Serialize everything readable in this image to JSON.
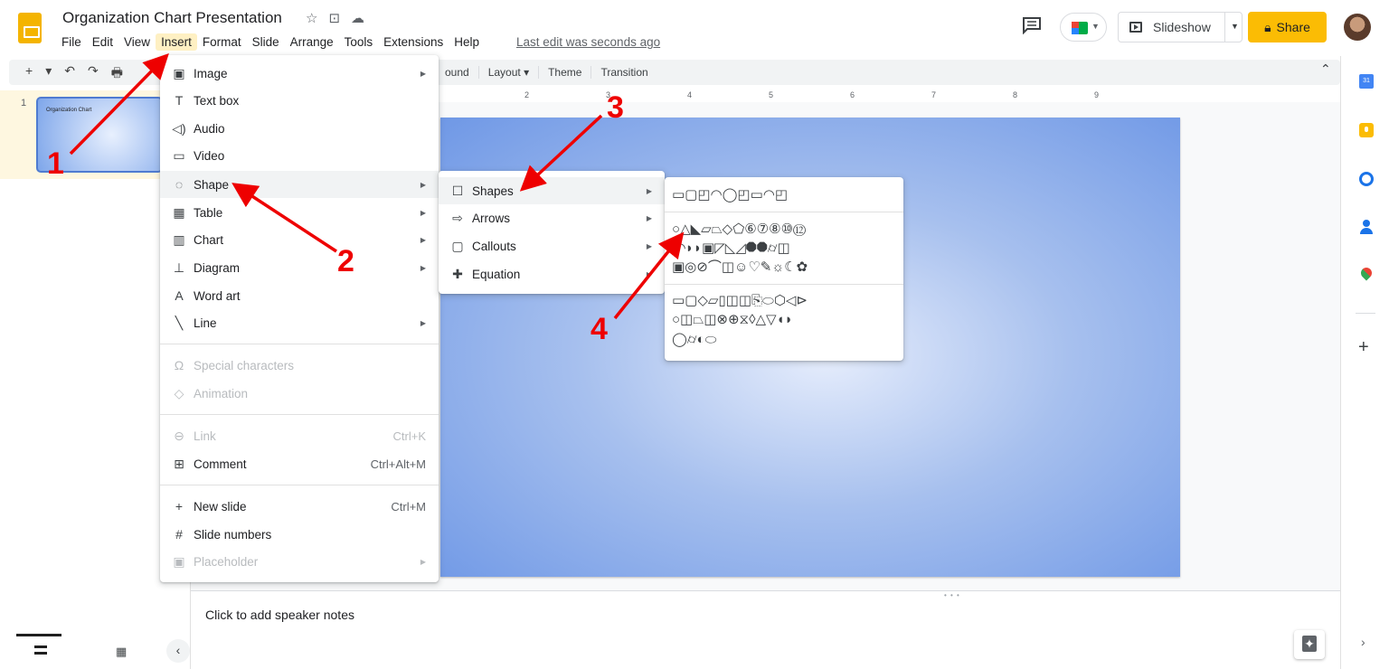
{
  "header": {
    "title": "Organization Chart Presentation",
    "menus": [
      "File",
      "Edit",
      "View",
      "Insert",
      "Format",
      "Slide",
      "Arrange",
      "Tools",
      "Extensions",
      "Help"
    ],
    "active_menu": "Insert",
    "last_edit": "Last edit was seconds ago",
    "slideshow_label": "Slideshow",
    "share_label": "Share",
    "title_icons": [
      "☆",
      "⊡",
      "☁"
    ]
  },
  "toolbar": {
    "left_icons": [
      "+",
      "▾",
      "↶",
      "↷",
      "🖶"
    ],
    "right_items": [
      "ound",
      "Layout ▾",
      "Theme",
      "Transition"
    ],
    "collapse": "⌃"
  },
  "ruler": [
    "2",
    "3",
    "4",
    "5",
    "6",
    "7",
    "8",
    "9"
  ],
  "filmstrip": {
    "slide_number": "1",
    "thumb_title": "Organization Chart"
  },
  "notes": {
    "placeholder": "Click to add speaker notes"
  },
  "side_panel": {
    "calendar_day": "31",
    "add": "+",
    "expand": "›"
  },
  "insert_menu": [
    {
      "icon": "▣",
      "label": "Image",
      "submenu": true
    },
    {
      "icon": "T",
      "label": "Text box"
    },
    {
      "icon": "◁)",
      "label": "Audio"
    },
    {
      "icon": "▭",
      "label": "Video"
    },
    {
      "icon": "◌",
      "label": "Shape",
      "submenu": true,
      "highlight": true
    },
    {
      "icon": "▦",
      "label": "Table",
      "submenu": true
    },
    {
      "icon": "▥",
      "label": "Chart",
      "submenu": true
    },
    {
      "icon": "⊥",
      "label": "Diagram",
      "submenu": true
    },
    {
      "icon": "A",
      "label": "Word art"
    },
    {
      "icon": "╲",
      "label": "Line",
      "submenu": true
    },
    {
      "icon": "Ω",
      "label": "Special characters",
      "disabled": true
    },
    {
      "icon": "◇",
      "label": "Animation",
      "disabled": true
    },
    {
      "icon": "⊖",
      "label": "Link",
      "shortcut": "Ctrl+K",
      "disabled": true
    },
    {
      "icon": "⊞",
      "label": "Comment",
      "shortcut": "Ctrl+Alt+M"
    },
    {
      "icon": "+",
      "label": "New slide",
      "shortcut": "Ctrl+M"
    },
    {
      "icon": "#",
      "label": "Slide numbers"
    },
    {
      "icon": "▣",
      "label": "Placeholder",
      "submenu": true,
      "disabled": true
    }
  ],
  "shape_menu": [
    {
      "icon": "☐",
      "label": "Shapes",
      "submenu": true,
      "highlight": true
    },
    {
      "icon": "⇨",
      "label": "Arrows",
      "submenu": true
    },
    {
      "icon": "▢",
      "label": "Callouts",
      "submenu": true
    },
    {
      "icon": "✚",
      "label": "Equation",
      "submenu": true
    }
  ],
  "shapes_rows": [
    "▭▢◰◠◯◰▭◠◰",
    "○△◣▱⏢◇⬠⑥⑦⑧⑩⑫",
    "◔◝◗◗▣◸◺◿⯃⯃⌭◫",
    "▣◎⊘⌒◫☺♡✎☼☾✿",
    "▭▢◇▱▯◫◫⎘⬭⬡◁⊳",
    "○◫⏢◫⊗⊕⧖◊△▽◖◗",
    "◯⌭◐⬭"
  ],
  "annotations": [
    "1",
    "2",
    "3",
    "4"
  ],
  "colors": {
    "accent": "#fbbc04",
    "arrow": "#e00000",
    "active_menu_bg": "#fef0c3"
  }
}
